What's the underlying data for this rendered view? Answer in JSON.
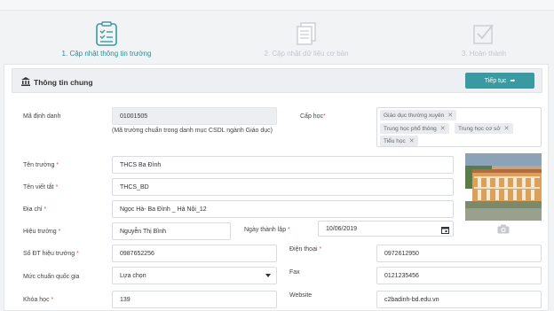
{
  "steps": [
    {
      "label": "1. Cập nhật thông tin trường",
      "state": "active",
      "icon": "checklist-icon"
    },
    {
      "label": "2. Cập nhật dữ liệu cơ bản",
      "state": "inactive",
      "icon": "documents-icon"
    },
    {
      "label": "3. Hoàn thành",
      "state": "inactive",
      "icon": "checkbox-icon"
    }
  ],
  "card": {
    "title": "Thông tin chung",
    "next_button": "Tiếp tục",
    "icon": "bank-icon"
  },
  "form": {
    "ma_dinh_danh": {
      "label": "Mã định danh",
      "value": "01001505",
      "hint": "(Mã trường chuẩn trong danh mục CSDL ngành Giáo dục)"
    },
    "cap_hoc": {
      "label": "Cấp học",
      "required": "*",
      "tags": [
        "Giáo dục thường xuyên",
        "Trung học phổ thông",
        "Trung học cơ sở",
        "Tiểu học"
      ]
    },
    "ten_truong": {
      "label": "Tên trường",
      "required": "*",
      "value": "THCS Ba Đình"
    },
    "ten_viet_tat": {
      "label": "Tên viết tắt",
      "required": "*",
      "value": "THCS_BD"
    },
    "dia_chi": {
      "label": "Địa chỉ",
      "required": "*",
      "value": "Ngọc Hà- Ba Đình _ Hà Nội_12"
    },
    "hieu_truong": {
      "label": "Hiệu trưởng",
      "required": "*",
      "value": "Nguyễn Thị Bình"
    },
    "ngay_thanh_lap": {
      "label": "Ngày thành lập",
      "required": "*",
      "value": "10/06/2019"
    },
    "sdt_hieu_truong": {
      "label": "Số ĐT hiệu trưởng",
      "required": "*",
      "value": "0987652256"
    },
    "dien_thoai": {
      "label": "Điện thoại",
      "required": "*",
      "value": "0972612950"
    },
    "muc_chuan": {
      "label": "Mức chuẩn quốc gia",
      "value": "Lựa chọn"
    },
    "fax": {
      "label": "Fax",
      "value": "0121235456"
    },
    "khoa_hoc": {
      "label": "Khóa học",
      "required": "*",
      "value": "139"
    },
    "website": {
      "label": "Website",
      "value": "c2badinh-bd.edu.vn"
    }
  },
  "colors": {
    "accent": "#3a9aa2",
    "step_active": "#2a8c93",
    "required": "#d9534f"
  }
}
